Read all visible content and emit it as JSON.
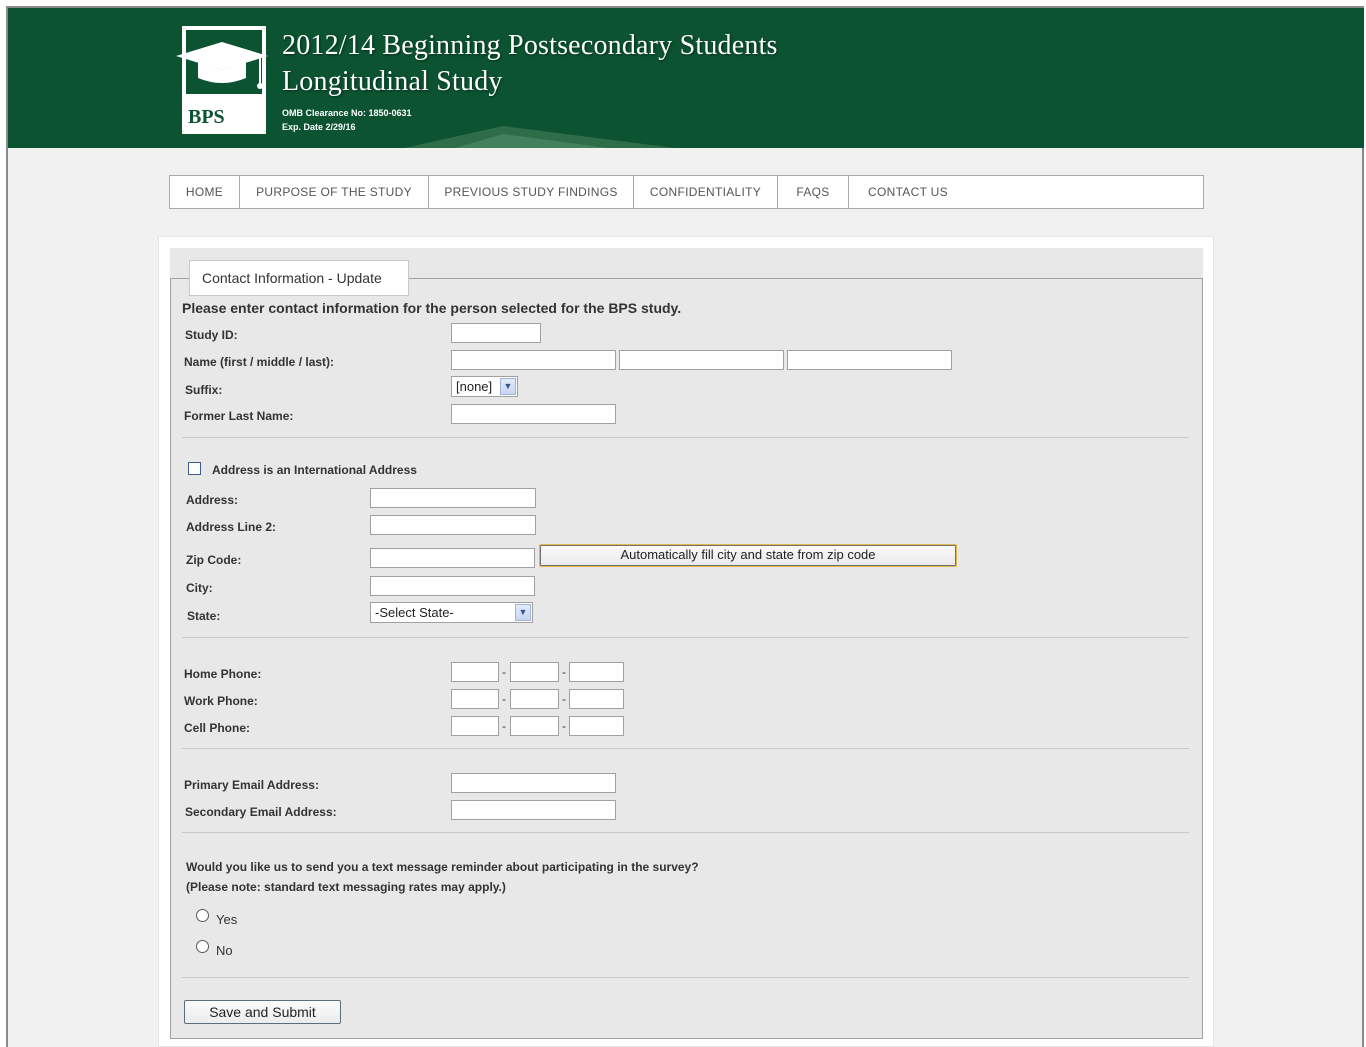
{
  "header": {
    "title_line1": "2012/14 Beginning Postsecondary Students",
    "title_line2": "Longitudinal Study",
    "omb_clearance": "OMB Clearance No: 1850-0631",
    "exp_date": "Exp. Date 2/29/16",
    "logo_text": "BPS"
  },
  "nav": {
    "items": [
      {
        "label": "HOME"
      },
      {
        "label": "PURPOSE OF THE STUDY"
      },
      {
        "label": "PREVIOUS STUDY FINDINGS"
      },
      {
        "label": "CONFIDENTIALITY"
      },
      {
        "label": "FAQS"
      },
      {
        "label": "CONTACT US"
      }
    ]
  },
  "form": {
    "legend": "Contact Information - Update",
    "intro": "Please enter contact information for the person selected for the BPS study.",
    "study_id_label": "Study ID:",
    "name_label": "Name  (first / middle / last):",
    "suffix_label": "Suffix:",
    "suffix_value": "[none]",
    "former_last_name_label": "Former Last Name:",
    "international_label": "Address is an International Address",
    "address_label": "Address:",
    "address2_label": "Address Line 2:",
    "zip_label": "Zip Code:",
    "autofill_button": "Automatically fill city and state from zip code",
    "city_label": "City:",
    "state_label": "State:",
    "state_value": "-Select State-",
    "home_phone_label": "Home Phone:",
    "work_phone_label": "Work Phone:",
    "cell_phone_label": "Cell Phone:",
    "phone_sep": "-",
    "primary_email_label": "Primary Email Address:",
    "secondary_email_label": "Secondary Email Address:",
    "text_question": "Would you like us to send you a text message reminder about participating in the survey?",
    "text_note": "(Please note: standard text messaging rates may apply.)",
    "yes_label": "Yes",
    "no_label": "No",
    "submit_button": "Save and Submit"
  },
  "colors": {
    "header_green": "#0b5331",
    "panel_gray": "#e8e8e8"
  }
}
